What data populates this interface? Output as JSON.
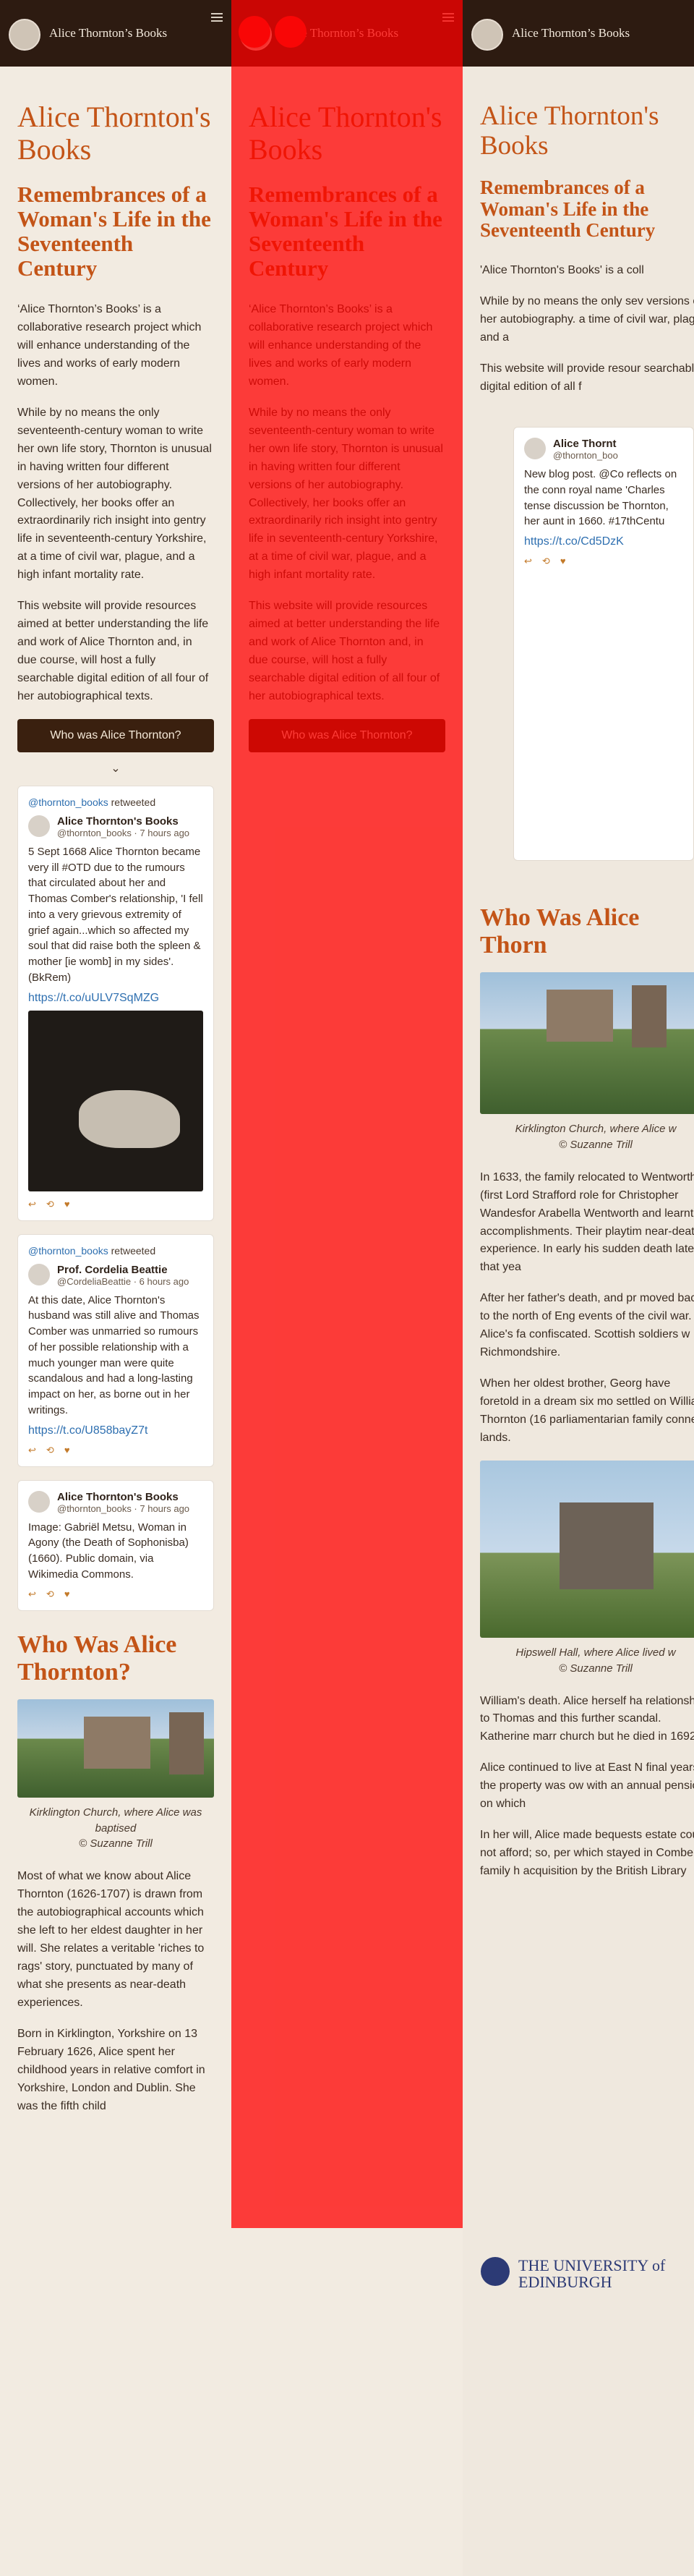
{
  "brand": {
    "title": "Alice Thornton’s Books"
  },
  "intro": {
    "h1": "Alice Thornton's Books",
    "h2": "Remembrances of a Woman's Life in the Seventeenth Century",
    "p1": "‘Alice Thornton’s Books’ is a collaborative research project which will enhance understanding of the lives and works of early modern women.",
    "p2": "While by no means the only seventeenth-century woman to write her own life story, Thornton is unusual in having written four different versions of her autobiography. Collectively, her books offer an extraordinarily rich insight into gentry life in seventeenth-century Yorkshire, at a time of civil war, plague, and a high infant mortality rate.",
    "p3": "This website will provide resources aimed at better understanding the life and work of Alice Thornton and, in due course, will host a fully searchable digital edition of all four of her autobiographical texts.",
    "cta": "Who was Alice Thornton?"
  },
  "tweets": [
    {
      "retweet_label": "@thornton_books",
      "retweet_suffix": "retweeted",
      "name": "Alice Thornton's Books",
      "handle": "@thornton_books · 7 hours ago",
      "text": "5 Sept 1668 Alice Thornton became very ill #OTD due to the rumours that circulated about her and Thomas Comber's relationship, 'I fell into a very grievous extremity of grief again...which so affected my soul that did raise both the spleen & mother [ie womb] in my sides'. (BkRem)",
      "link": "https://t.co/uULV7SqMZG"
    },
    {
      "retweet_label": "@thornton_books",
      "retweet_suffix": "retweeted",
      "name": "Prof. Cordelia Beattie",
      "handle": "@CordeliaBeattie · 6 hours ago",
      "text": "At this date, Alice Thornton's husband was still alive and Thomas Comber was unmarried so rumours of her possible relationship with a much younger man were quite scandalous and had a long-lasting impact on her, as borne out in her writings.",
      "link": "https://t.co/U858bayZ7t"
    },
    {
      "name": "Alice Thornton's Books",
      "handle": "@thornton_books · 7 hours ago",
      "text": "Image: Gabriël Metsu, Woman in Agony (the Death of Sophonisba) (1660). Public domain, via Wikimedia Commons."
    }
  ],
  "who": {
    "title": "Who Was Alice Thornton?",
    "caption": "Kirklington Church, where Alice was baptised\n© Suzanne Trill",
    "p1": "Most of what we know about Alice Thornton (1626-1707) is drawn from the autobiographical accounts which she left to her eldest daughter in her will. She relates a veritable 'riches to rags' story, punctuated by many of what she presents as near-death experiences.",
    "p2": "Born in Kirklington, Yorkshire on 13 February 1626, Alice spent her childhood years in relative comfort in Yorkshire, London and Dublin. She was the fifth child"
  },
  "col3": {
    "lead": "'Alice Thornton's Books' is a coll",
    "p2": "While by no means the only sev versions of her autobiography. a time of civil war, plague, and a",
    "p3": "This website will provide resour searchable digital edition of all f",
    "sidebar_title": "Alice Thornt",
    "sidebar_handle": "@thornton_boo",
    "sidebar_text": "New blog post. @Co reflects on the conn royal name 'Charles tense discussion be Thornton, her aunt in 1660. #17thCentu",
    "sidebar_link": "https://t.co/Cd5DzK",
    "who_title": "Who Was Alice Thorn",
    "kirk_caption": "Kirklington Church, where Alice w\n© Suzanne Trill",
    "text1": "In 1633, the family relocated to Wentworth (first Lord Strafford role for Christopher Wandesfor Arabella Wentworth and learnt accomplishments. Their playtim near-death experience. In early his sudden death later that yea",
    "text2": "After her father's death, and pr moved back to the north of Eng events of the civil war. Alice's fa confiscated. Scottish soldiers w Richmondshire.",
    "text3": "When her oldest brother, Georg have foretold in a dream six mo settled on William Thornton (16 parliamentarian family connecti lands.",
    "hip_caption": "Hipswell Hall, where Alice lived w\n© Suzanne Trill",
    "text4": "William's death. Alice herself ha relationship to Thomas and this further scandal. Katherine marr church but he died in 1692.",
    "text5": "Alice continued to live at East N final years the property was ow with an annual pension on which",
    "text6": "In her will, Alice made bequests estate could not afford; so, per which stayed in Comber family h acquisition by the British Library",
    "uni": "THE UNIVERSITY of EDINBURGH"
  }
}
